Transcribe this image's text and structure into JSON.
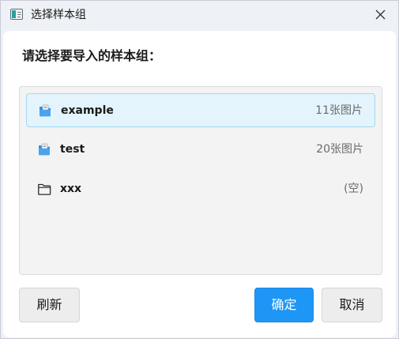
{
  "window": {
    "title": "选择样本组"
  },
  "prompt": "请选择要导入的样本组：",
  "groups": [
    {
      "name": "example",
      "count": "11张图片",
      "icon": "folder-open-icon",
      "selected": true
    },
    {
      "name": "test",
      "count": "20张图片",
      "icon": "folder-open-icon",
      "selected": false
    },
    {
      "name": "xxx",
      "count": "(空)",
      "icon": "folder-outline-icon",
      "selected": false
    }
  ],
  "buttons": {
    "refresh": "刷新",
    "ok": "确定",
    "cancel": "取消"
  },
  "colors": {
    "accent": "#1e96f5",
    "selected_bg": "#e3f4fc",
    "selected_border": "#a2d8f2",
    "folder_blue": "#3a8fd8"
  }
}
